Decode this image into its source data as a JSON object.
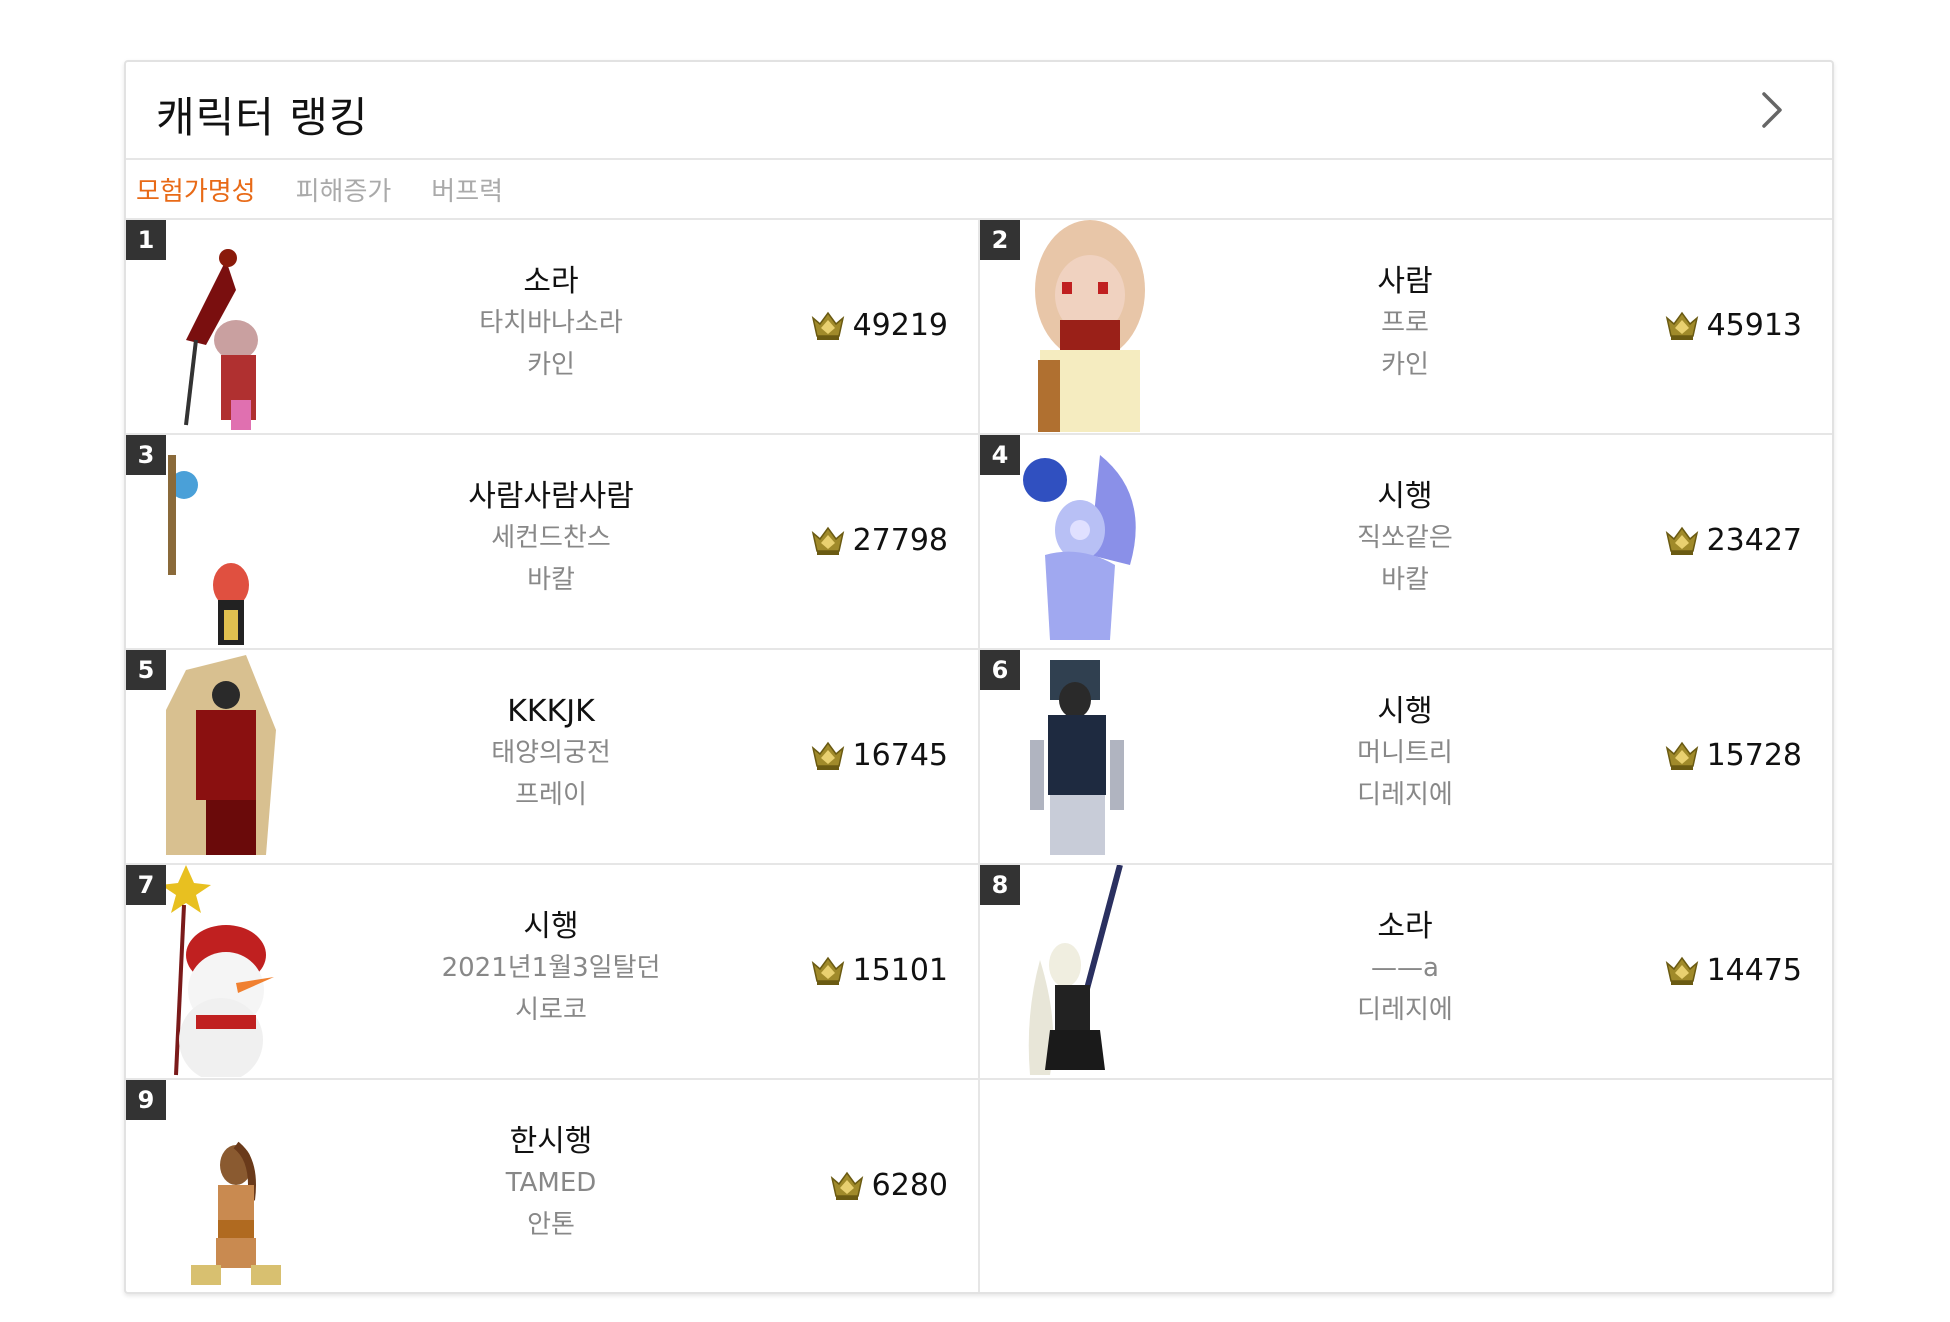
{
  "header": {
    "title": "캐릭터 랭킹"
  },
  "tabs": [
    {
      "label": "모험가명성",
      "active": true
    },
    {
      "label": "피해증가",
      "active": false
    },
    {
      "label": "버프력",
      "active": false
    }
  ],
  "icons": {
    "more": "chevron-right-icon",
    "fame": "crown-fame-icon"
  },
  "colors": {
    "accent": "#e86a17",
    "badge_bg": "#333333",
    "fame_icon": "#a08a2a"
  },
  "rankings": [
    {
      "rank": "1",
      "name": "소라",
      "guild": "타치바나소라",
      "server": "카인",
      "fame": "49219",
      "avatar": "red-witch"
    },
    {
      "rank": "2",
      "name": "사람",
      "guild": "프로",
      "server": "카인",
      "fame": "45913",
      "avatar": "blonde-girl"
    },
    {
      "rank": "3",
      "name": "사람사람사람",
      "guild": "세컨드찬스",
      "server": "바칼",
      "fame": "27798",
      "avatar": "red-hair-staff"
    },
    {
      "rank": "4",
      "name": "시행",
      "guild": "직쏘같은",
      "server": "바칼",
      "fame": "23427",
      "avatar": "winged-spirit"
    },
    {
      "rank": "5",
      "name": "KKKJK",
      "guild": "태양의궁전",
      "server": "프레이",
      "fame": "16745",
      "avatar": "red-armor"
    },
    {
      "rank": "6",
      "name": "시행",
      "guild": "머니트리",
      "server": "디레지에",
      "fame": "15728",
      "avatar": "gunner"
    },
    {
      "rank": "7",
      "name": "시행",
      "guild": "2021년1월3일탈던",
      "server": "시로코",
      "fame": "15101",
      "avatar": "snowman"
    },
    {
      "rank": "8",
      "name": "소라",
      "guild": "——a",
      "server": "디레지에",
      "fame": "14475",
      "avatar": "gothic-staff"
    },
    {
      "rank": "9",
      "name": "한시행",
      "guild": "TAMED",
      "server": "안톤",
      "fame": "6280",
      "avatar": "fighter"
    }
  ]
}
